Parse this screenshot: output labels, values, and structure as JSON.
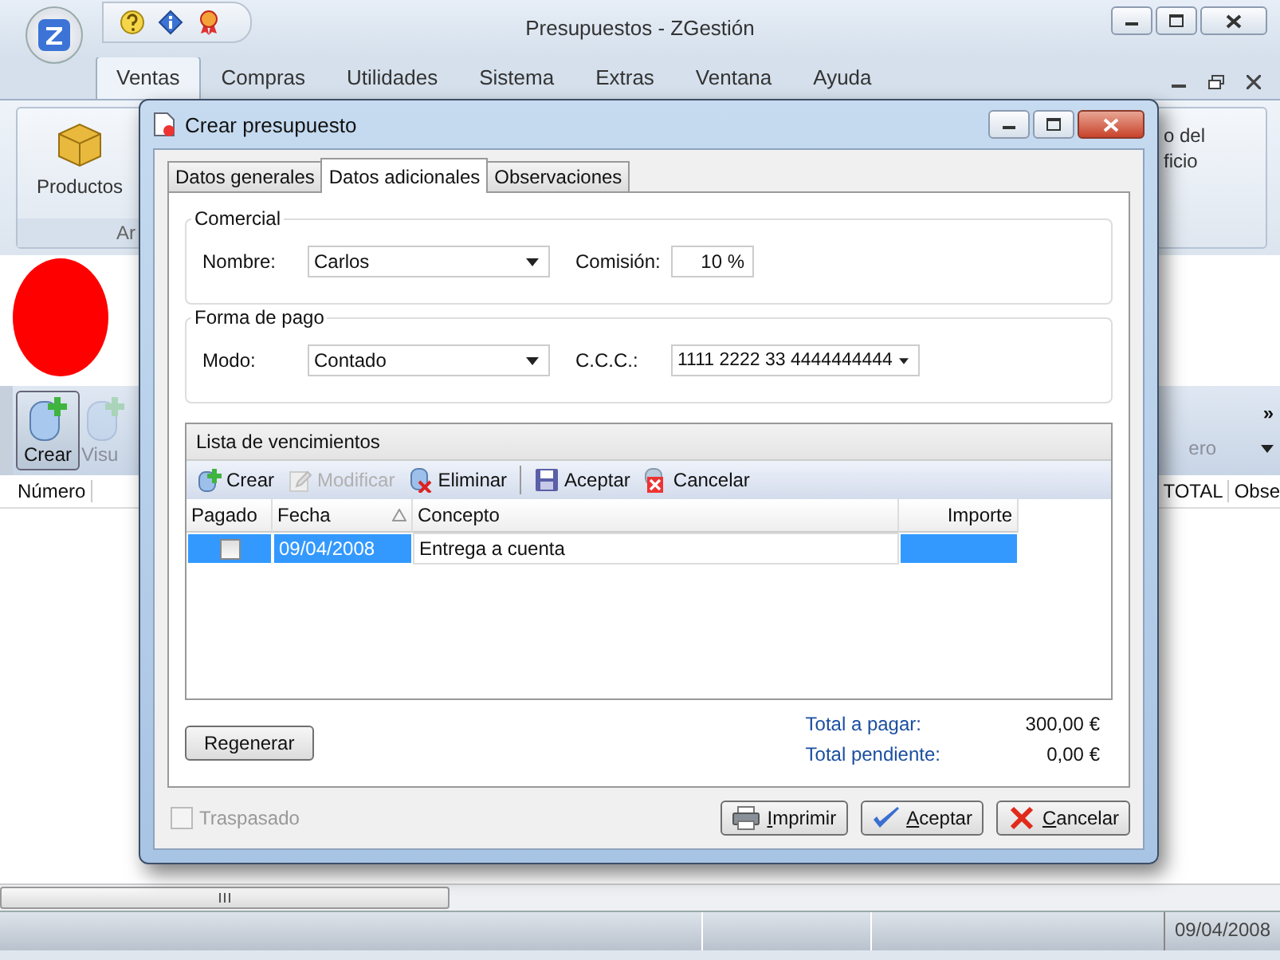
{
  "window": {
    "title": "Presupuestos - ZGestión"
  },
  "ribbon_tabs": [
    {
      "label": "Ventas",
      "selected": true
    },
    {
      "label": "Compras",
      "selected": false
    },
    {
      "label": "Utilidades",
      "selected": false
    },
    {
      "label": "Sistema",
      "selected": false
    },
    {
      "label": "Extras",
      "selected": false
    },
    {
      "label": "Ventana",
      "selected": false
    },
    {
      "label": "Ayuda",
      "selected": false
    }
  ],
  "ribbon": {
    "left_button": "Productos",
    "left_group_label": "Ar",
    "right_button_lines": [
      "o del",
      "ficio"
    ]
  },
  "toolbar": {
    "items": [
      {
        "label": "Crear",
        "disabled": false
      },
      {
        "label": "Visu",
        "disabled": true
      }
    ],
    "right_item": "ero",
    "overflow": "»"
  },
  "table": {
    "left_columns": [
      "Número"
    ],
    "right_columns": [
      "TOTAL",
      "Obse"
    ]
  },
  "status_bar": {
    "date": "09/04/2008"
  },
  "dialog": {
    "title": "Crear presupuesto",
    "tabs": [
      {
        "label": "Datos generales",
        "selected": false
      },
      {
        "label": "Datos adicionales",
        "selected": true
      },
      {
        "label": "Observaciones",
        "selected": false
      }
    ],
    "comercial": {
      "legend": "Comercial",
      "nombre_label": "Nombre:",
      "nombre": "Carlos",
      "comision_label": "Comisión:",
      "comision": "10 %"
    },
    "forma_pago": {
      "legend": "Forma de pago",
      "modo_label": "Modo:",
      "modo": "Contado",
      "ccc_label": "C.C.C.:",
      "ccc": "1111 2222 33 4444444444"
    },
    "vencimientos": {
      "title": "Lista de vencimientos",
      "toolbar": [
        {
          "label": "Crear",
          "kind": "create",
          "disabled": false
        },
        {
          "label": "Modificar",
          "kind": "edit",
          "disabled": true
        },
        {
          "label": "Eliminar",
          "kind": "delete",
          "disabled": false
        },
        {
          "label": "Aceptar",
          "kind": "save",
          "disabled": false
        },
        {
          "label": "Cancelar",
          "kind": "cancel",
          "disabled": false
        }
      ],
      "columns": [
        {
          "label": "Pagado",
          "sorted": false
        },
        {
          "label": "Fecha",
          "sorted": true
        },
        {
          "label": "Concepto",
          "sorted": false
        },
        {
          "label": "Importe",
          "sorted": false
        }
      ],
      "rows": [
        {
          "pagado": false,
          "fecha": "09/04/2008",
          "concepto": "Entrega a cuenta",
          "selected": true
        }
      ]
    },
    "regenerar": "Regenerar",
    "totals": [
      {
        "label": "Total a pagar:",
        "value": "300,00 €"
      },
      {
        "label": "Total pendiente:",
        "value": "0,00 €"
      }
    ],
    "traspasado": {
      "label": "Traspasado",
      "checked": false,
      "disabled": true
    },
    "buttons": [
      {
        "label": "Imprimir",
        "kind": "print"
      },
      {
        "label": "Aceptar",
        "kind": "ok"
      },
      {
        "label": "Cancelar",
        "kind": "cancel"
      }
    ]
  }
}
